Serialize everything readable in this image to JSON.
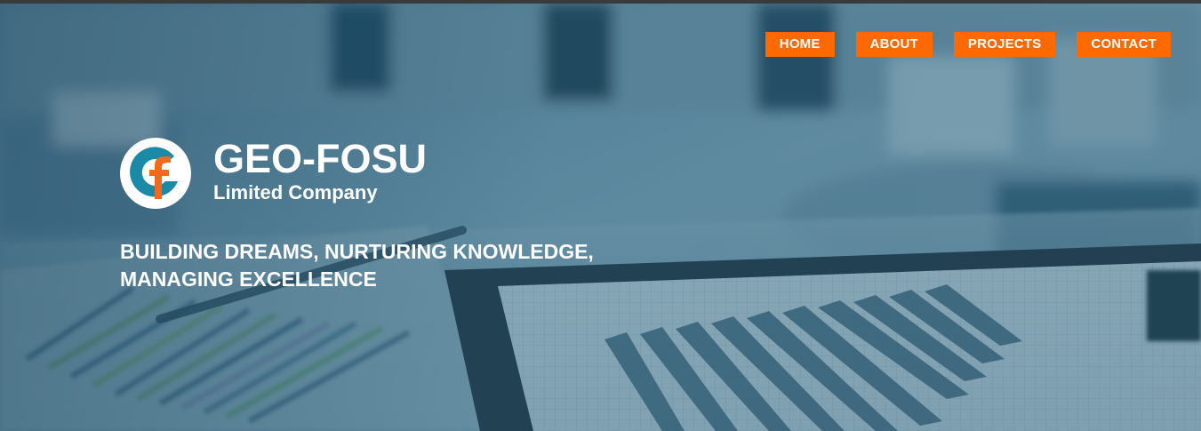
{
  "nav": {
    "items": [
      {
        "label": "HOME"
      },
      {
        "label": "ABOUT"
      },
      {
        "label": "PROJECTS"
      },
      {
        "label": "CONTACT"
      }
    ],
    "accent_color": "#ff6a00"
  },
  "brand": {
    "name": "GEO-FOSU",
    "subtitle": "Limited Company",
    "logo_colors": {
      "teal": "#1b8aa6",
      "orange": "#f26b1d"
    }
  },
  "hero": {
    "tagline_lines": [
      "BUILDING DREAMS, NURTURING KNOWLEDGE,",
      "MANAGING EXCELLENCE"
    ],
    "background_icon": "office-desk-charts-photo",
    "overlay_color": "#2d5f7a"
  }
}
